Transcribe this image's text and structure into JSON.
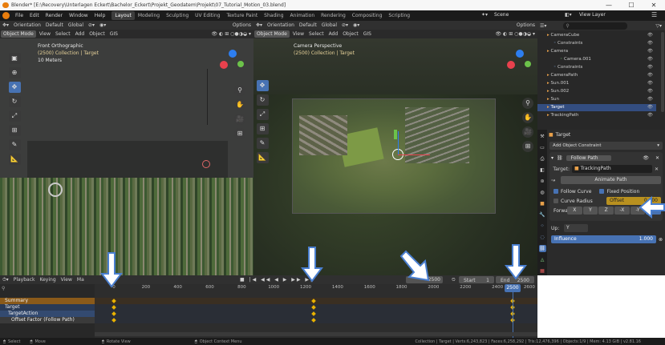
{
  "window": {
    "title": "Blender* [E:\\Recovery\\Unterlagen Eckert\\Bachelor_Eckert\\Projekt_Geodatem\\Projekt\\07_Tutorial_Motion_03.blend]",
    "minimize": "—",
    "maximize": "☐",
    "close": "✕"
  },
  "menubar": {
    "menus": [
      "File",
      "Edit",
      "Render",
      "Window",
      "Help"
    ],
    "workspaces": [
      "Layout",
      "Modeling",
      "Sculpting",
      "UV Editing",
      "Texture Paint",
      "Shading",
      "Animation",
      "Rendering",
      "Compositing",
      "Scripting"
    ],
    "active_workspace": "Layout",
    "scene": "Scene",
    "view_layer": "View Layer"
  },
  "viewport_left": {
    "header_top": [
      "Orientation",
      "Default",
      "Global",
      "Options"
    ],
    "header_menu": [
      "Object Mode",
      "View",
      "Select",
      "Add",
      "Object",
      "GIS"
    ],
    "overlay_title": "Front Orthographic",
    "overlay_collection": "(2500) Collection | Target",
    "overlay_scale": "10 Meters"
  },
  "viewport_right": {
    "header_top": [
      "Orientation",
      "Default",
      "Global",
      "Options"
    ],
    "header_menu": [
      "Object Mode",
      "View",
      "Select",
      "Add",
      "Object",
      "GIS"
    ],
    "overlay_title": "Camera Perspective",
    "overlay_collection": "(2500) Collection | Target"
  },
  "outliner": {
    "search_placeholder": "",
    "items": [
      {
        "label": "CameraCube",
        "indent": 1,
        "icon": "▸",
        "color": "#e8a04a"
      },
      {
        "label": "Constraints",
        "indent": 2,
        "icon": "◦",
        "color": "#8fb7e8"
      },
      {
        "label": "Camera",
        "indent": 1,
        "icon": "▸",
        "color": "#e8a04a"
      },
      {
        "label": "Camera.001",
        "indent": 3,
        "icon": "◦",
        "color": "#7fd17f"
      },
      {
        "label": "Constraints",
        "indent": 2,
        "icon": "◦",
        "color": "#8fb7e8"
      },
      {
        "label": "CameraPath",
        "indent": 1,
        "icon": "▸",
        "color": "#e8a04a"
      },
      {
        "label": "Sun.001",
        "indent": 1,
        "icon": "▸",
        "color": "#e8a04a"
      },
      {
        "label": "Sun.002",
        "indent": 1,
        "icon": "▸",
        "color": "#e8a04a"
      },
      {
        "label": "Sun",
        "indent": 1,
        "icon": "▸",
        "color": "#e8a04a"
      },
      {
        "label": "Target",
        "indent": 1,
        "icon": "▸",
        "color": "#e8a04a",
        "selected": true
      },
      {
        "label": "TrackingPath",
        "indent": 1,
        "icon": "▸",
        "color": "#e8a04a"
      }
    ]
  },
  "properties": {
    "object_name": "Target",
    "add_constraint": "Add Object Constraint",
    "constraint_name": "Follow Path",
    "target_label": "Target:",
    "target_value": "TrackingPath",
    "animate_path": "Animate Path",
    "follow_curve": "Follow Curve",
    "fixed_position": "Fixed Position",
    "curve_radius": "Curve Radius",
    "offset_label": "Offset",
    "offset_value": "0.000",
    "forward_label": "Forwa",
    "forward_axes": [
      "X",
      "Y",
      "Z",
      "-X",
      "-Y",
      "-Z"
    ],
    "active_forward": "-Z",
    "up_label": "Up:",
    "up_value": "Y",
    "influence_label": "Influence",
    "influence_value": "1.000"
  },
  "timeline": {
    "header_menus": [
      "Playback",
      "Keying",
      "View",
      "Ma"
    ],
    "current_frame": "2500",
    "start_label": "Start",
    "start_value": "1",
    "end_label": "End",
    "end_value": "2500",
    "frame_badge": "2500",
    "ruler": [
      "0",
      "200",
      "400",
      "600",
      "800",
      "1000",
      "1200",
      "1400",
      "1600",
      "1800",
      "2000",
      "2200",
      "2400",
      "2500",
      "2600"
    ],
    "channels": [
      "Summary",
      "Target",
      "TargetAction",
      "Offset Factor (Follow Path)"
    ]
  },
  "statusbar": {
    "select": "Select",
    "move": "Move",
    "rotate": "Rotate View",
    "context_menu": "Object Context Menu",
    "info": "Collection | Target | Verts:6,243,823 | Faces:6,258,292 | Tris:12,476,396 | Objects:1/9 | Mem: 4.13 GiB | v2.81.16"
  },
  "colors": {
    "accent": "#4772b3",
    "keyframe": "#e8b100",
    "annotation_arrow": "#4a7fd0",
    "window_bg": "#1b1b1b"
  }
}
